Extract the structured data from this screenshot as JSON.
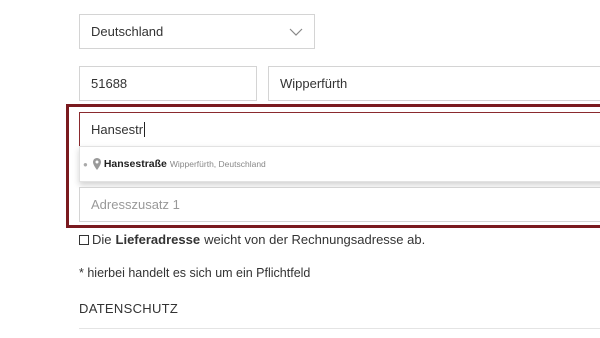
{
  "form": {
    "country": {
      "value": "Deutschland"
    },
    "zip": {
      "value": "51688"
    },
    "city": {
      "value": "Wipperfürth"
    },
    "street": {
      "value": "Hansestr"
    },
    "autocomplete": {
      "items": [
        {
          "main": "Hansestraße",
          "secondary": "Wipperfürth, Deutschland"
        }
      ]
    },
    "address_line2": {
      "placeholder": "Adresszusatz 1"
    },
    "delivery_checkbox": {
      "prefix": "Die",
      "bold": "Lieferadresse",
      "suffix": "weicht von der Rechnungsadresse ab.",
      "checked": false
    },
    "required_note": "* hierbei handelt es sich um ein Pflichtfeld",
    "section_title": "DATENSCHUTZ"
  },
  "colors": {
    "highlight_border": "#7a1a1f",
    "field_border": "#d4d4d4",
    "text": "#333333",
    "placeholder": "#999999"
  },
  "icons": {
    "select": "chevron-down-icon",
    "suggestion": "map-pin-icon"
  }
}
